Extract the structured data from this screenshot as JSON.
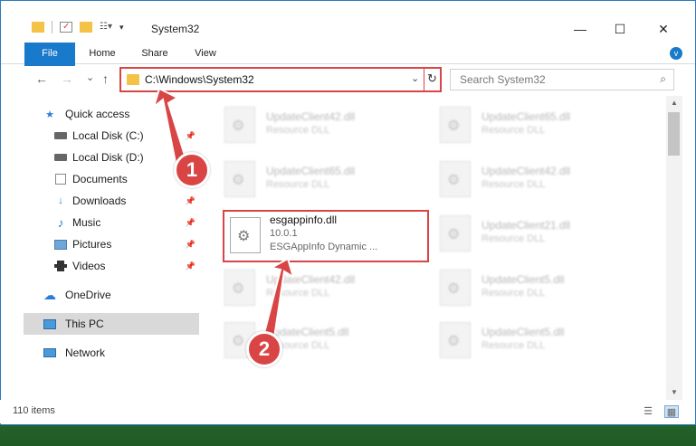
{
  "window": {
    "title": "System32",
    "controls": {
      "minimize": "—",
      "maximize": "☐",
      "close": "✕"
    }
  },
  "ribbon": {
    "tabs": [
      "File",
      "Home",
      "Share",
      "View"
    ],
    "expand": "v"
  },
  "nav": {
    "back": "←",
    "forward": "→",
    "recent": "⌄",
    "up": "↑"
  },
  "address": {
    "path": "C:\\Windows\\System32",
    "dropdown": "⌄",
    "refresh": "↻"
  },
  "search": {
    "placeholder": "Search System32",
    "icon": "⌕"
  },
  "sidebar": {
    "items": [
      {
        "label": "Quick access",
        "icon": "star-icon"
      },
      {
        "label": "Local Disk (C:)",
        "icon": "drive-icon"
      },
      {
        "label": "Local Disk (D:)",
        "icon": "drive-icon"
      },
      {
        "label": "Documents",
        "icon": "documents-icon"
      },
      {
        "label": "Downloads",
        "icon": "download-icon"
      },
      {
        "label": "Music",
        "icon": "music-icon"
      },
      {
        "label": "Pictures",
        "icon": "pictures-icon"
      },
      {
        "label": "Videos",
        "icon": "videos-icon"
      },
      {
        "label": "OneDrive",
        "icon": "cloud-icon"
      },
      {
        "label": "This PC",
        "icon": "computer-icon"
      },
      {
        "label": "Network",
        "icon": "network-icon"
      }
    ]
  },
  "files": {
    "blurred": [
      {
        "name": "UpdateClient42.dll",
        "desc": "Resource DLL"
      },
      {
        "name": "UpdateClient65.dll",
        "desc": "Resource DLL"
      },
      {
        "name": "UpdateClient65.dll",
        "desc": "Resource DLL"
      },
      {
        "name": "UpdateClient42.dll",
        "desc": "Resource DLL"
      },
      {
        "name": "UpdateClient21.dll",
        "desc": "Resource DLL"
      },
      {
        "name": "UpdateClient42.dll",
        "desc": "Resource DLL"
      },
      {
        "name": "UpdateClient5.dll",
        "desc": "Resource DLL"
      },
      {
        "name": "UpdateClient5.dll",
        "desc": "Resource DLL"
      },
      {
        "name": "UpdateClient5.dll",
        "desc": "Resource DLL"
      }
    ],
    "highlighted": {
      "name": "esgappinfo.dll",
      "version": "10.0.1",
      "desc": "ESGAppInfo Dynamic ..."
    }
  },
  "status": {
    "count": "110 items"
  },
  "callouts": [
    "1",
    "2"
  ],
  "colors": {
    "accent": "#1979ca",
    "highlight": "#d94545"
  }
}
